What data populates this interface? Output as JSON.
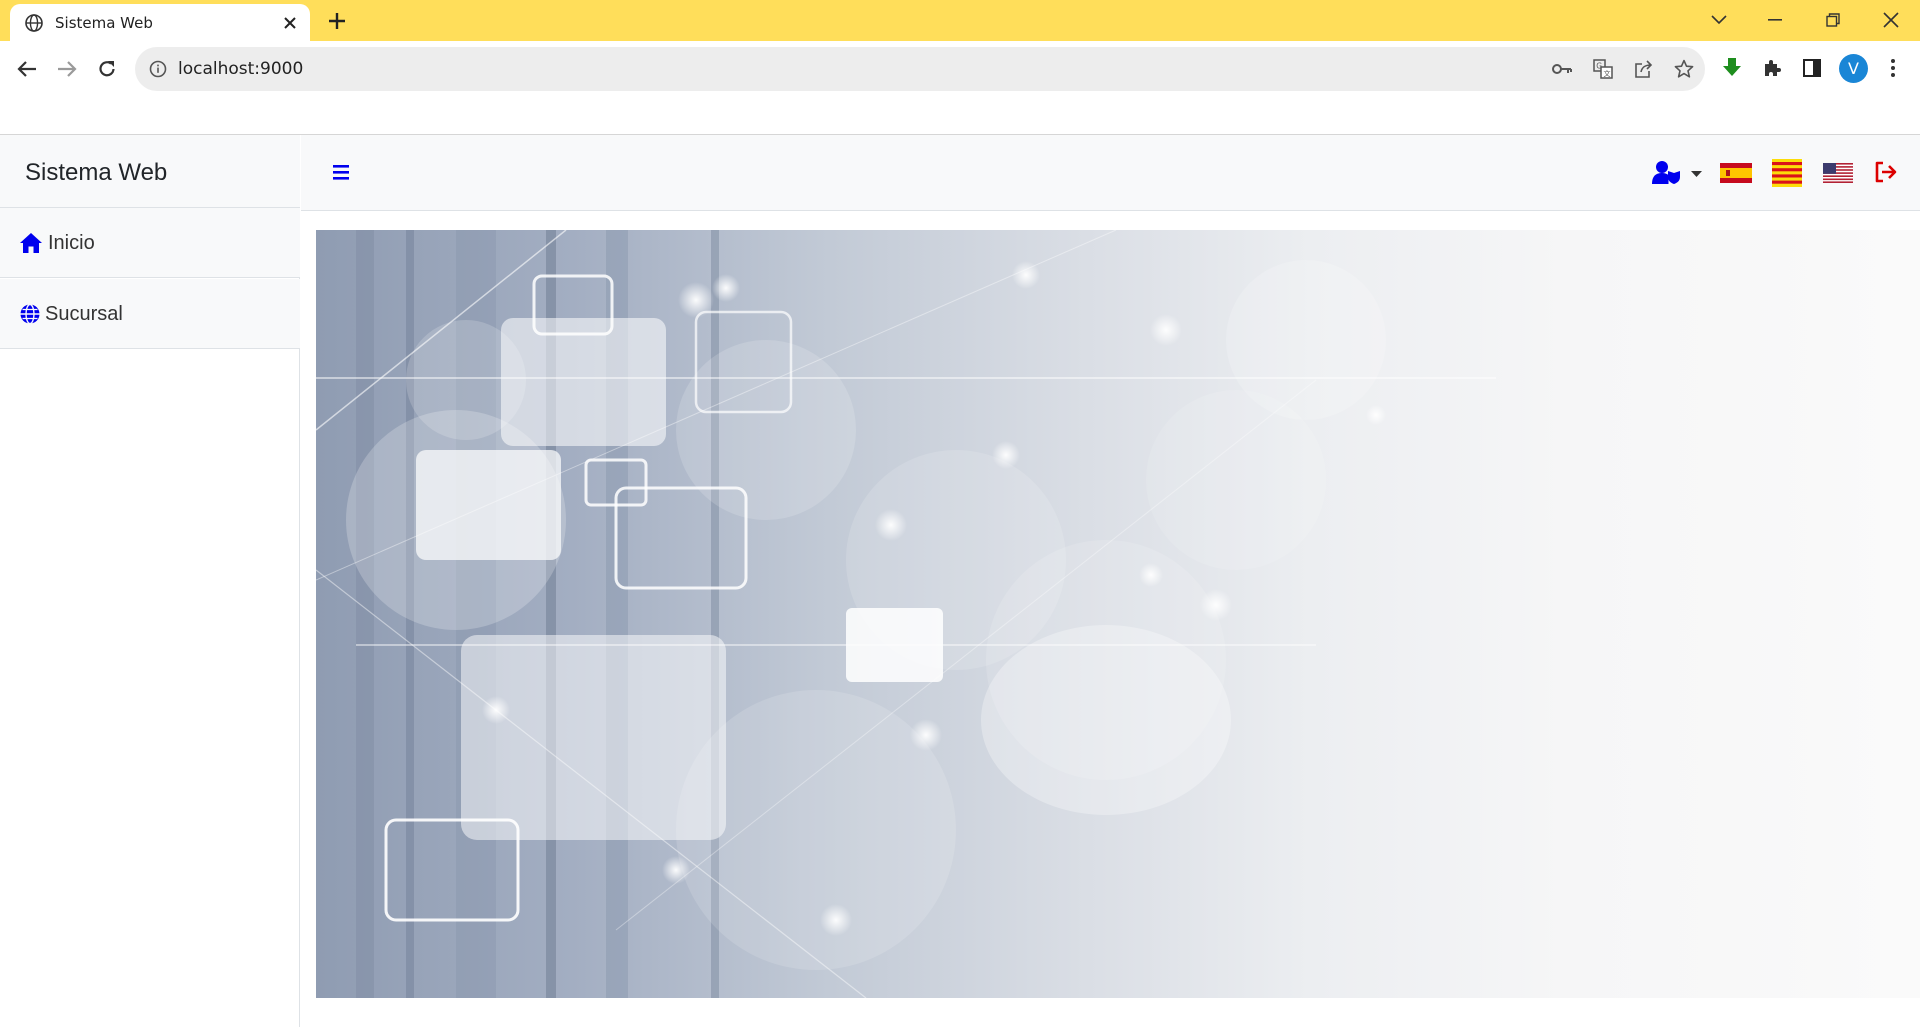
{
  "browser": {
    "tab_title": "Sistema Web",
    "url": "localhost:9000",
    "profile_initial": "V"
  },
  "app": {
    "brand": "Sistema Web",
    "sidebar": {
      "items": [
        {
          "label": "Inicio",
          "icon": "home-icon"
        },
        {
          "label": "Sucursal",
          "icon": "globe-icon"
        }
      ]
    },
    "topbar": {
      "languages": [
        "es",
        "ca",
        "en"
      ],
      "icons": [
        "hamburger-icon",
        "user-shield-icon",
        "logout-icon"
      ]
    },
    "colors": {
      "accent": "#0000EE",
      "logout": "#DC0000",
      "tabbar": "#FFDE5A"
    }
  }
}
